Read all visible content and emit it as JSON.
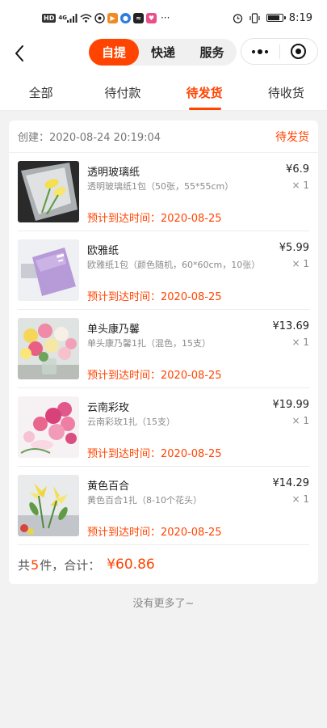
{
  "status_bar": {
    "left_icons": [
      "hd-icon",
      "signal-icon",
      "wifi-icon",
      "app-icon-a",
      "app-icon-play",
      "app-icon-b",
      "app-icon-c",
      "app-icon-heart",
      "more-icon"
    ],
    "hd_label": "HD",
    "network_label": "4G",
    "more_label": "···",
    "time": "8:19"
  },
  "nav": {
    "segments": [
      "自提",
      "快递",
      "服务"
    ],
    "active_segment": 0
  },
  "tabs": {
    "items": [
      "全部",
      "待付款",
      "待发货",
      "待收货"
    ],
    "active": 2
  },
  "order": {
    "created": "创建：2020-08-24 20:19:04",
    "status": "待发货",
    "items": [
      {
        "name": "透明玻璃纸",
        "spec": "透明玻璃纸1包（50张，55*55cm）",
        "price": "¥6.9",
        "qty": "× 1",
        "eta": "预计到达时间：2020-08-25",
        "image": "clear-wrapping-paper"
      },
      {
        "name": "欧雅纸",
        "spec": "欧雅纸1包（颜色随机，60*60cm，10张）",
        "price": "¥5.99",
        "qty": "× 1",
        "eta": "预计到达时间：2020-08-25",
        "image": "purple-wrapping-paper"
      },
      {
        "name": "单头康乃馨",
        "spec": "单头康乃馨1扎（混色，15支）",
        "price": "¥13.69",
        "qty": "× 1",
        "eta": "预计到达时间：2020-08-25",
        "image": "mixed-carnations"
      },
      {
        "name": "云南彩玫",
        "spec": "云南彩玫1扎（15支）",
        "price": "¥19.99",
        "qty": "× 1",
        "eta": "预计到达时间：2020-08-25",
        "image": "pink-roses"
      },
      {
        "name": "黄色百合",
        "spec": "黄色百合1扎（8-10个花头）",
        "price": "¥14.29",
        "qty": "× 1",
        "eta": "预计到达时间：2020-08-25",
        "image": "yellow-lilies"
      }
    ],
    "summary_prefix": "共",
    "summary_count": "5",
    "summary_mid": "件，合计：",
    "summary_total": "¥60.86"
  },
  "footer": {
    "no_more": "没有更多了~"
  },
  "colors": {
    "accent": "#ff4400",
    "background": "#f2f2f2"
  }
}
